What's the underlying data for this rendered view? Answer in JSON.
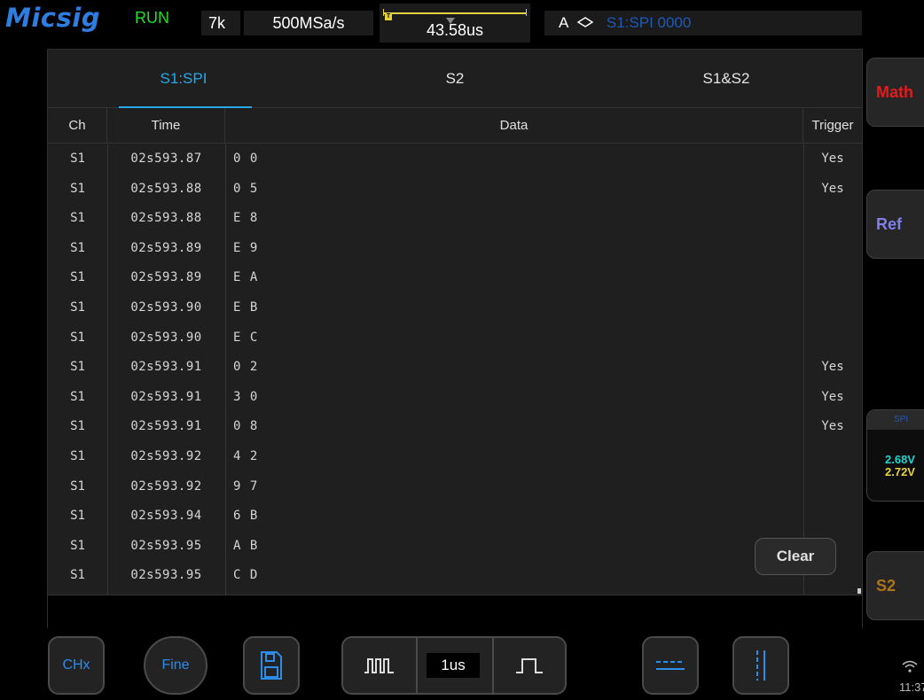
{
  "brand": "Micsig",
  "status": {
    "run_state": "RUN",
    "memory_depth": "7k",
    "sample_rate": "500MSa/s",
    "time_offset": "43.58us",
    "trigger_mode": "A",
    "trigger_source": "S1:SPI 0000"
  },
  "panel": {
    "tabs": [
      {
        "label": "S1:SPI",
        "active": true
      },
      {
        "label": "S2",
        "active": false
      },
      {
        "label": "S1&S2",
        "active": false
      }
    ],
    "columns": {
      "ch": "Ch",
      "time": "Time",
      "data": "Data",
      "trigger": "Trigger"
    },
    "rows": [
      {
        "ch": "S1",
        "time": "02s593.87",
        "data": "0 0",
        "trigger": "Yes"
      },
      {
        "ch": "S1",
        "time": "02s593.88",
        "data": "0 5",
        "trigger": "Yes"
      },
      {
        "ch": "S1",
        "time": "02s593.88",
        "data": "E 8",
        "trigger": ""
      },
      {
        "ch": "S1",
        "time": "02s593.89",
        "data": "E 9",
        "trigger": ""
      },
      {
        "ch": "S1",
        "time": "02s593.89",
        "data": "E A",
        "trigger": ""
      },
      {
        "ch": "S1",
        "time": "02s593.90",
        "data": "E B",
        "trigger": ""
      },
      {
        "ch": "S1",
        "time": "02s593.90",
        "data": "E C",
        "trigger": ""
      },
      {
        "ch": "S1",
        "time": "02s593.91",
        "data": "0 2",
        "trigger": "Yes"
      },
      {
        "ch": "S1",
        "time": "02s593.91",
        "data": "3 0",
        "trigger": "Yes"
      },
      {
        "ch": "S1",
        "time": "02s593.91",
        "data": "0 8",
        "trigger": "Yes"
      },
      {
        "ch": "S1",
        "time": "02s593.92",
        "data": "4 2",
        "trigger": ""
      },
      {
        "ch": "S1",
        "time": "02s593.92",
        "data": "9 7",
        "trigger": ""
      },
      {
        "ch": "S1",
        "time": "02s593.94",
        "data": "6 B",
        "trigger": ""
      },
      {
        "ch": "S1",
        "time": "02s593.95",
        "data": "A B",
        "trigger": ""
      },
      {
        "ch": "S1",
        "time": "02s593.95",
        "data": "C D",
        "trigger": ""
      }
    ],
    "clear_label": "Clear"
  },
  "side": {
    "math_label": "Math",
    "ref_label": "Ref",
    "spi_header": "SPI",
    "spi_threshold_1": "2.68V",
    "spi_threshold_2": "2.72V",
    "s2_label": "S2"
  },
  "toolbar": {
    "chx_label": "CHx",
    "fine_label": "Fine",
    "time_value": "1us"
  },
  "system": {
    "clock": "11:37"
  },
  "colors": {
    "accent_blue": "#27a9e8",
    "run_green": "#22dd22",
    "math_red": "#e21c1c",
    "ref_purple": "#8080e8",
    "s2_orange": "#b07416",
    "ch1_yellow": "#e6d23c",
    "ch2_cyan": "#1fd3d3"
  }
}
